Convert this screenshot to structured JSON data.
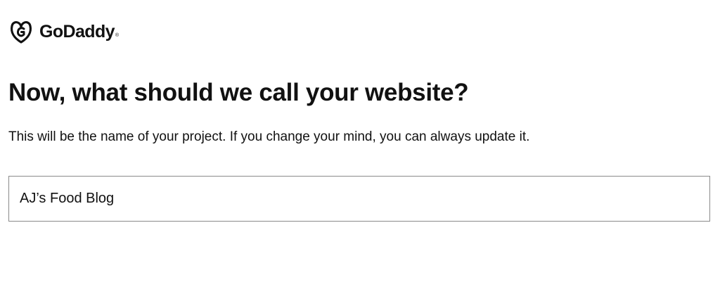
{
  "brand": {
    "name": "GoDaddy",
    "trademark": "®",
    "logo_icon": "godaddy-logo-icon",
    "color": "#111111"
  },
  "main": {
    "title": "Now, what should we call your website?",
    "subtitle": "This will be the name of your project. If you change your mind, you can always update it.",
    "website_name_input": {
      "value": "AJ’s Food Blog",
      "border_color": "#8a8a8a"
    }
  }
}
